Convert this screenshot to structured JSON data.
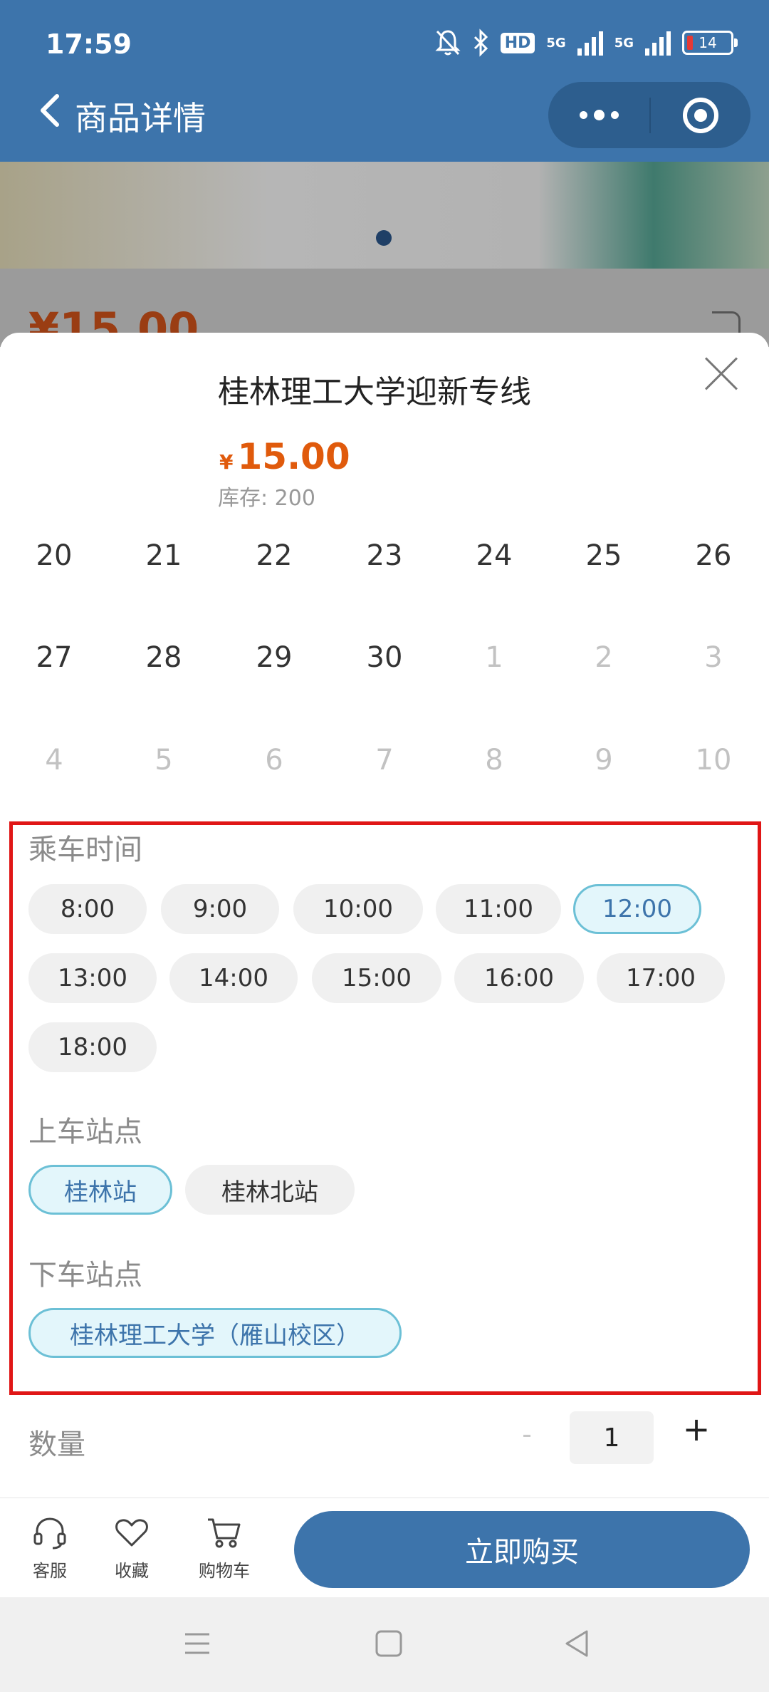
{
  "status_bar": {
    "time": "17:59",
    "hd_label": "HD",
    "net1": "5G",
    "net2": "5G",
    "battery": "14"
  },
  "nav": {
    "title": "商品详情"
  },
  "background": {
    "price": "¥15.00"
  },
  "sheet": {
    "title": "桂林理工大学迎新专线",
    "currency": "¥",
    "price": "15.00",
    "stock": "库存: 200"
  },
  "calendar": {
    "rows": [
      [
        {
          "d": "20",
          "m": false
        },
        {
          "d": "21",
          "m": false
        },
        {
          "d": "22",
          "m": false
        },
        {
          "d": "23",
          "m": false
        },
        {
          "d": "24",
          "m": false
        },
        {
          "d": "25",
          "m": false
        },
        {
          "d": "26",
          "m": false
        }
      ],
      [
        {
          "d": "27",
          "m": false
        },
        {
          "d": "28",
          "m": false
        },
        {
          "d": "29",
          "m": false
        },
        {
          "d": "30",
          "m": false
        },
        {
          "d": "1",
          "m": true
        },
        {
          "d": "2",
          "m": true
        },
        {
          "d": "3",
          "m": true
        }
      ],
      [
        {
          "d": "4",
          "m": true
        },
        {
          "d": "5",
          "m": true
        },
        {
          "d": "6",
          "m": true
        },
        {
          "d": "7",
          "m": true
        },
        {
          "d": "8",
          "m": true
        },
        {
          "d": "9",
          "m": true
        },
        {
          "d": "10",
          "m": true
        }
      ]
    ]
  },
  "ride_time": {
    "label": "乘车时间",
    "selected": "12:00",
    "options": [
      "8:00",
      "9:00",
      "10:00",
      "11:00",
      "12:00",
      "13:00",
      "14:00",
      "15:00",
      "16:00",
      "17:00",
      "18:00"
    ]
  },
  "boarding": {
    "label": "上车站点",
    "selected": "桂林站",
    "options": [
      "桂林站",
      "桂林北站"
    ]
  },
  "alighting": {
    "label": "下车站点",
    "selected": "桂林理工大学（雁山校区）",
    "options": [
      "桂林理工大学（雁山校区）"
    ]
  },
  "quantity": {
    "label": "数量",
    "minus": "-",
    "value": "1",
    "plus": "+"
  },
  "actions": {
    "service": "客服",
    "favorite": "收藏",
    "cart": "购物车",
    "buy": "立即购买"
  },
  "colors": {
    "brand": "#3d74ab",
    "price": "#e05a0c",
    "highlight_border": "#e01616",
    "chip_selected_border": "#6cc0d6"
  }
}
